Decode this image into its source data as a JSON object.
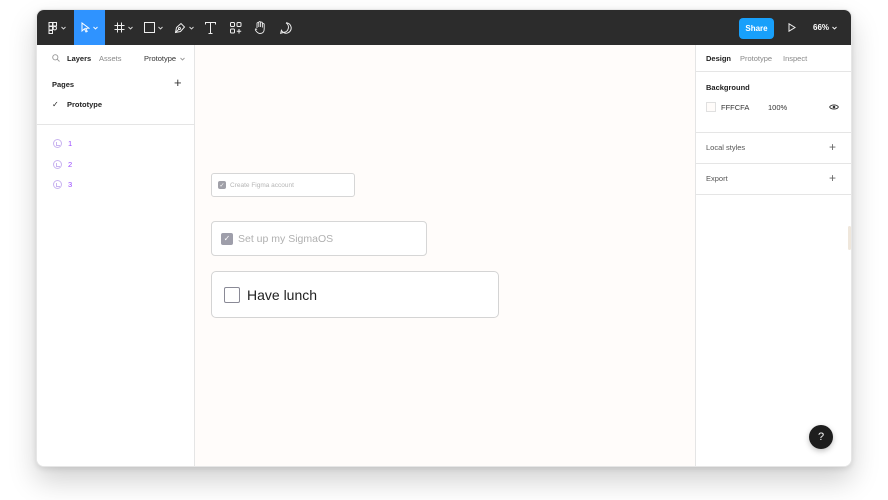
{
  "toolbar": {
    "share_label": "Share",
    "zoom_label": "66%",
    "tools": [
      "main-menu-icon",
      "move-tool-icon",
      "frame-tool-icon",
      "shape-tool-icon",
      "pen-tool-icon",
      "text-tool-icon",
      "resources-icon",
      "hand-tool-icon",
      "comment-tool-icon"
    ],
    "accent": "#18a0fb",
    "active_tool_bg": "#2f93ff",
    "bar_bg": "#2c2c2c"
  },
  "left_panel": {
    "tabs": {
      "layers": "Layers",
      "assets": "Assets",
      "page_dropdown": "Prototype"
    },
    "pages_title": "Pages",
    "current_page": "Prototype",
    "layers": [
      "1",
      "2",
      "3"
    ],
    "layer_color": "#9747ff"
  },
  "canvas": {
    "background": "#FFFCFA",
    "cards": [
      {
        "label": "Create Figma account",
        "checked": true
      },
      {
        "label": "Set up my SigmaOS",
        "checked": true
      },
      {
        "label": "Have lunch",
        "checked": false
      }
    ]
  },
  "right_panel": {
    "tabs": {
      "design": "Design",
      "prototype": "Prototype",
      "inspect": "Inspect"
    },
    "background_title": "Background",
    "background_hex": "FFFCFA",
    "background_opacity": "100%",
    "local_styles": "Local styles",
    "export": "Export"
  },
  "help_label": "?"
}
